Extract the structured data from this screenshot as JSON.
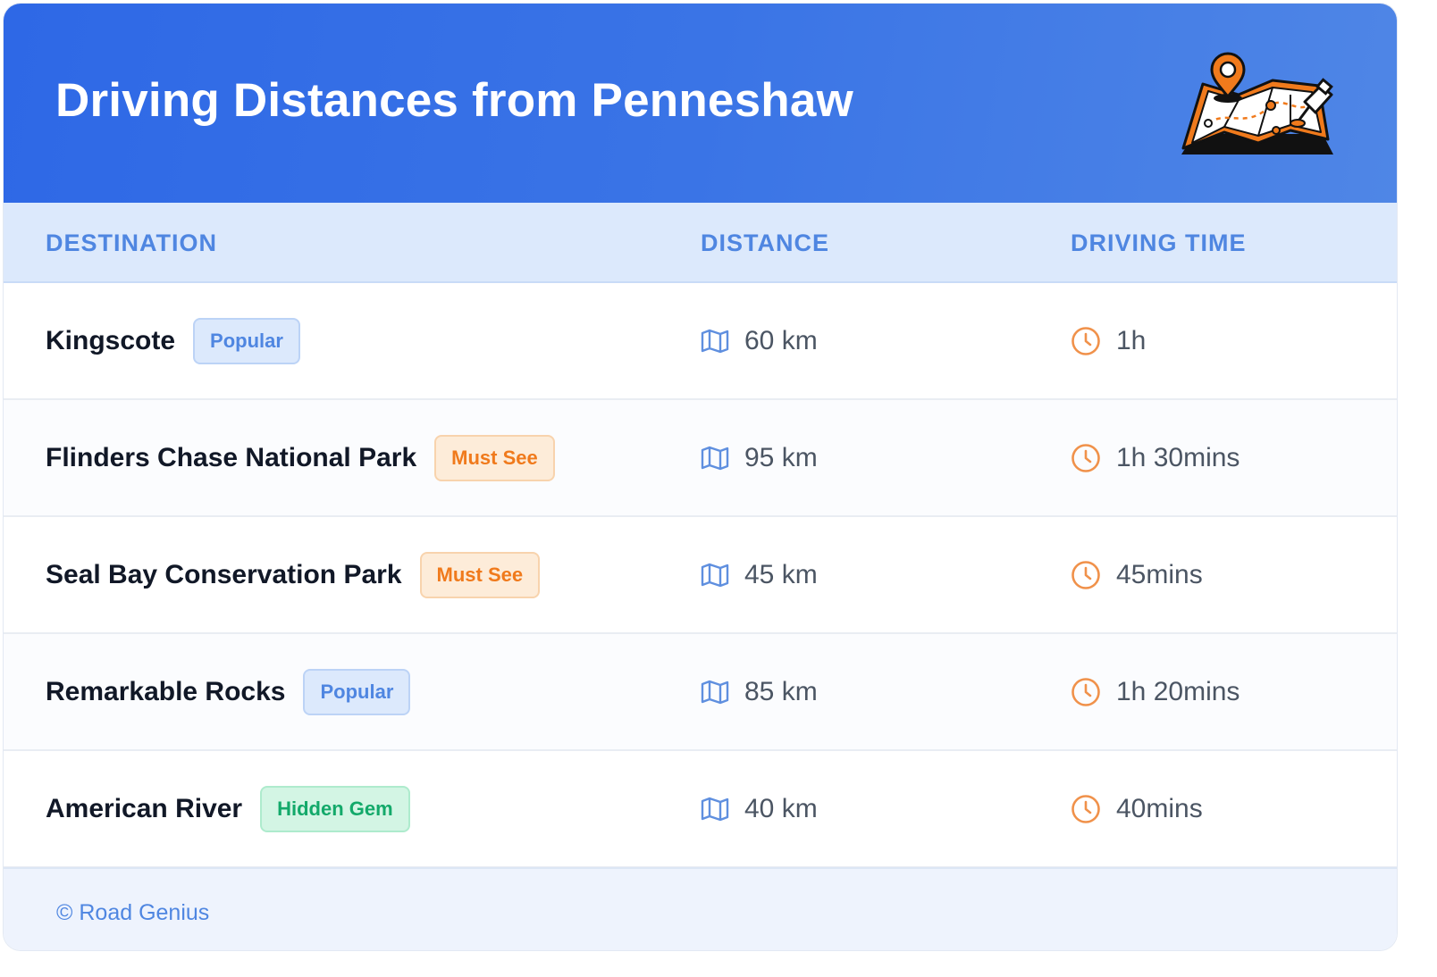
{
  "header": {
    "title": "Driving Distances from Penneshaw",
    "illustration_icon": "map-with-pins-icon"
  },
  "table": {
    "columns": [
      "DESTINATION",
      "DISTANCE",
      "DRIVING TIME"
    ],
    "rows": [
      {
        "destination": "Kingscote",
        "badge": "Popular",
        "badge_color": "blue",
        "distance": "60 km",
        "time": "1h"
      },
      {
        "destination": "Flinders Chase National Park",
        "badge": "Must See",
        "badge_color": "orange",
        "distance": "95 km",
        "time": "1h 30mins"
      },
      {
        "destination": "Seal Bay Conservation Park",
        "badge": "Must See",
        "badge_color": "orange",
        "distance": "45 km",
        "time": "45mins"
      },
      {
        "destination": "Remarkable Rocks",
        "badge": "Popular",
        "badge_color": "blue",
        "distance": "85 km",
        "time": "1h 20mins"
      },
      {
        "destination": "American River",
        "badge": "Hidden Gem",
        "badge_color": "green",
        "distance": "40 km",
        "time": "40mins"
      }
    ],
    "distance_icon": "map-icon",
    "time_icon": "clock-icon"
  },
  "footer": {
    "copyright": "© Road Genius"
  },
  "colors": {
    "header_gradient_start": "#2e68e6",
    "header_gradient_end": "#4f86e6",
    "accent_blue": "#4f86e1",
    "accent_orange": "#f07a1c",
    "accent_green": "#13a96a"
  }
}
